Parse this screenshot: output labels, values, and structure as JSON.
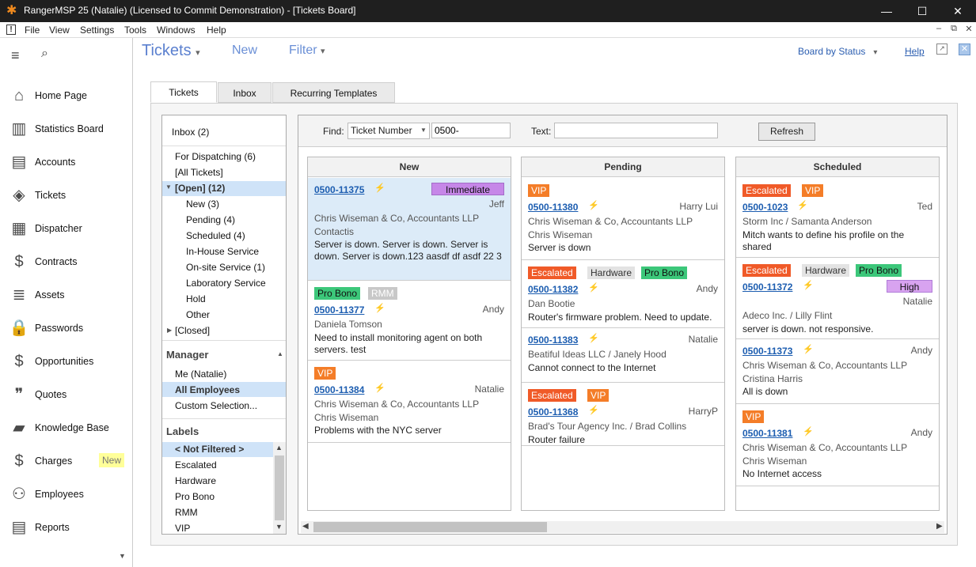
{
  "window": {
    "title": "RangerMSP 25 (Natalie)  (Licensed to Commit Demonstration) - [Tickets Board]"
  },
  "menu": [
    "File",
    "View",
    "Settings",
    "Tools",
    "Windows",
    "Help"
  ],
  "sidebar": {
    "items": [
      {
        "label": "Home Page",
        "icon": "home-icon"
      },
      {
        "label": "Statistics Board",
        "icon": "chart-icon"
      },
      {
        "label": "Accounts",
        "icon": "accounts-icon"
      },
      {
        "label": "Tickets",
        "icon": "ticket-icon"
      },
      {
        "label": "Dispatcher",
        "icon": "calendar-icon"
      },
      {
        "label": "Contracts",
        "icon": "contract-icon"
      },
      {
        "label": "Assets",
        "icon": "assets-icon"
      },
      {
        "label": "Passwords",
        "icon": "lock-icon"
      },
      {
        "label": "Opportunities",
        "icon": "opportunity-icon"
      },
      {
        "label": "Quotes",
        "icon": "quote-icon"
      },
      {
        "label": "Knowledge Base",
        "icon": "book-icon"
      },
      {
        "label": "Charges",
        "icon": "charges-icon"
      },
      {
        "label": "Employees",
        "icon": "employees-icon"
      },
      {
        "label": "Reports",
        "icon": "reports-icon"
      }
    ],
    "new_badge": "New"
  },
  "topbar": {
    "tickets": "Tickets",
    "new": "New",
    "filter": "Filter",
    "board_by": "Board by Status",
    "help": "Help"
  },
  "tabs": [
    "Tickets",
    "Inbox",
    "Recurring Templates"
  ],
  "left": {
    "inbox": "Inbox (2)",
    "items": [
      "For Dispatching (6)",
      "[All Tickets]",
      "[Open] (12)",
      "New (3)",
      "Pending (4)",
      "Scheduled (4)",
      "In-House Service",
      "On-site Service (1)",
      "Laboratory Service",
      "Hold",
      "Other",
      "[Closed]"
    ],
    "manager": "Manager",
    "manager_items": [
      "Me (Natalie)",
      "All Employees",
      "Custom Selection..."
    ],
    "labels": "Labels",
    "label_items": [
      "< Not Filtered >",
      "Escalated",
      "Hardware",
      "Pro Bono",
      "RMM",
      "VIP"
    ]
  },
  "find": {
    "label": "Find:",
    "field": "Ticket Number",
    "value": "0500-",
    "text_label": "Text:",
    "text_value": "",
    "refresh": "Refresh"
  },
  "columns": [
    {
      "title": "New",
      "cards": [
        {
          "id": "0500-11375",
          "badge": "Immediate",
          "owner": "Jeff",
          "account": "Chris Wiseman & Co, Accountants LLP",
          "contact": "Contactis",
          "desc": "Server is down. Server is down. Server is down. Server is down.123 aasdf df asdf 22 3"
        },
        {
          "tags": [
            "Pro Bono",
            "RMM"
          ],
          "id": "0500-11377",
          "owner": "Andy",
          "account": "Daniela Tomson",
          "desc": "Need to install monitoring agent on both servers. test"
        },
        {
          "tags": [
            "VIP"
          ],
          "id": "0500-11384",
          "owner": "Natalie",
          "account": "Chris Wiseman & Co, Accountants LLP",
          "contact": "Chris Wiseman",
          "desc": "Problems with the NYC server"
        }
      ]
    },
    {
      "title": "Pending",
      "cards": [
        {
          "tags": [
            "VIP"
          ],
          "id": "0500-11380",
          "owner": "Harry Lui",
          "account": "Chris Wiseman & Co, Accountants LLP",
          "contact": "Chris Wiseman",
          "desc": "Server is down"
        },
        {
          "tags": [
            "Escalated",
            "Hardware",
            "Pro Bono"
          ],
          "id": "0500-11382",
          "owner": "Andy",
          "account": "Dan Bootie",
          "desc": "Router's firmware problem. Need to update."
        },
        {
          "id": "0500-11383",
          "owner": "Natalie",
          "account": "Beatiful Ideas LLC / Janely Hood",
          "desc": "Cannot connect to the Internet"
        },
        {
          "tags": [
            "Escalated",
            "VIP"
          ],
          "id": "0500-11368",
          "owner": "HarryP",
          "account": "Brad's Tour  Agency Inc. / Brad Collins",
          "desc": "Router failure"
        }
      ]
    },
    {
      "title": "Scheduled",
      "cards": [
        {
          "tags": [
            "Escalated",
            "VIP"
          ],
          "id": "0500-1023",
          "owner": "Ted",
          "account": "Storm Inc / Samanta Anderson",
          "desc": "Mitch wants to define his profile on the shared"
        },
        {
          "tags": [
            "Escalated",
            "Hardware",
            "Pro Bono"
          ],
          "id": "0500-11372",
          "badge": "High",
          "owner": "Natalie",
          "account": "Adeco Inc. / Lilly Flint",
          "desc": "server is down.  not responsive."
        },
        {
          "id": "0500-11373",
          "owner": "Andy",
          "account": "Chris Wiseman & Co, Accountants LLP",
          "contact": "Cristina Harris",
          "desc": "All is down"
        },
        {
          "tags": [
            "VIP"
          ],
          "id": "0500-11381",
          "owner": "Andy",
          "account": "Chris Wiseman & Co, Accountants LLP",
          "contact": "Chris Wiseman",
          "desc": "No Internet access"
        }
      ]
    }
  ]
}
